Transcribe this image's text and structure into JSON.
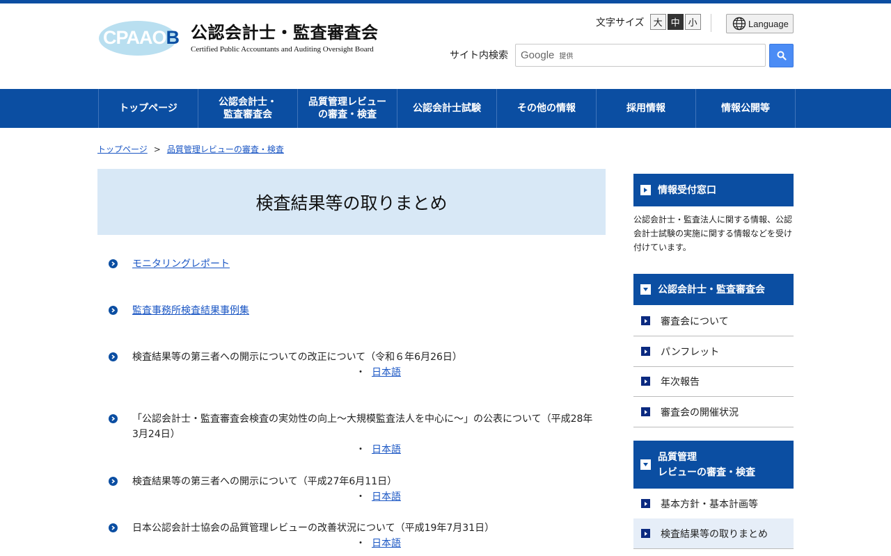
{
  "header": {
    "logo_mark_main": "CPAAO",
    "logo_mark_tail": "B",
    "org_name_jp": "公認会計士・監査審査会",
    "org_name_en": "Certified Public Accountants and Auditing Oversight Board",
    "font_size_label": "文字サイズ",
    "font_sizes": [
      "大",
      "中",
      "小"
    ],
    "font_size_selected": "中",
    "language_label": "Language",
    "search_label": "サイト内検索",
    "search_google": "Google",
    "search_provided": "提供"
  },
  "nav": {
    "items": [
      "トップページ",
      "公認会計士・\n監査審査会",
      "品質管理レビュー\nの審査・検査",
      "公認会計士試験",
      "その他の情報",
      "採用情報",
      "情報公開等"
    ]
  },
  "breadcrumb": {
    "home": "トップページ",
    "separator": ">",
    "current": "品質管理レビューの審査・検査"
  },
  "main": {
    "title": "検査結果等の取りまとめ",
    "entries": [
      {
        "text": "モニタリングレポート",
        "link": true
      },
      {
        "text": "監査事務所検査結果事例集",
        "link": true
      },
      {
        "text": "検査結果等の第三者への開示についての改正について（令和６年6月26日）",
        "link": false,
        "sub": "日本語"
      },
      {
        "text": "「公認会計士・監査審査会検査の実効性の向上～大規模監査法人を中心に～」の公表について（平成28年3月24日）",
        "link": false,
        "sub": "日本語"
      },
      {
        "text": "検査結果等の第三者への開示について（平成27年6月11日）",
        "link": false,
        "sub": "日本語"
      },
      {
        "text": "日本公認会計士協会の品質管理レビューの改善状況について（平成19年7月31日）",
        "link": false,
        "sub": "日本語"
      }
    ],
    "sub_dot": "・"
  },
  "sidebar": {
    "info_head": "情報受付窓口",
    "info_desc": "公認会計士・監査法人に関する情報、公認会計士試験の実施に関する情報などを受け付けています。",
    "section1_head": "公認会計士・監査審査会",
    "section1_items": [
      "審査会について",
      "パンフレット",
      "年次報告",
      "審査会の開催状況"
    ],
    "section2_head": "品質管理\nレビューの審査・検査",
    "section2_items": [
      "基本方針・基本計画等",
      "検査結果等の取りまとめ"
    ]
  },
  "colors": {
    "brand_blue": "#0b4ea2",
    "title_bg": "#d8e8f6",
    "link": "#1a56c4"
  }
}
